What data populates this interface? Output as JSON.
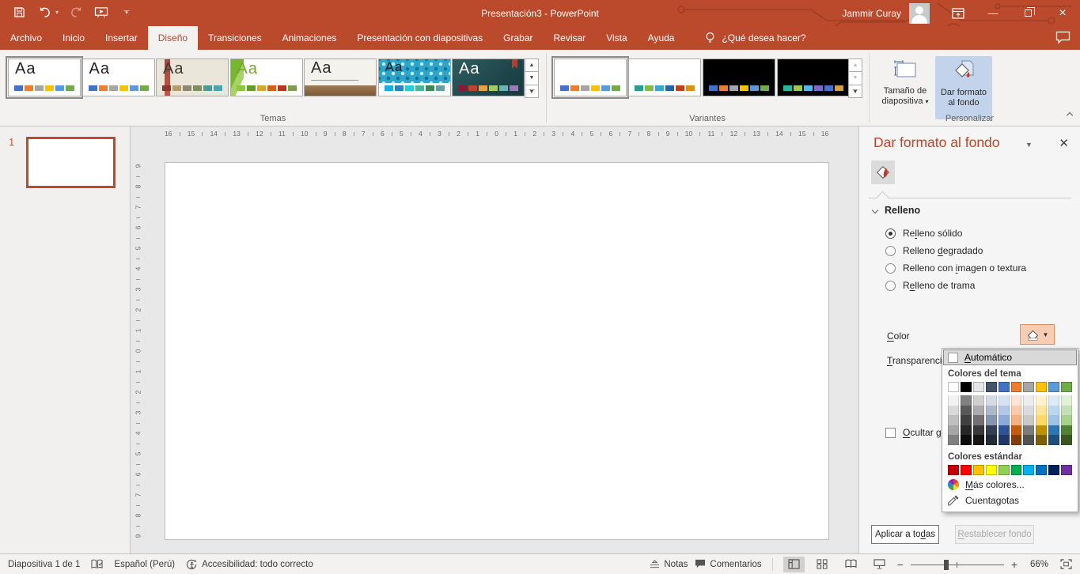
{
  "titlebar": {
    "title": "Presentación3 - PowerPoint",
    "user": "Jammir Curay"
  },
  "tabs": [
    {
      "label": "Archivo",
      "active": false
    },
    {
      "label": "Inicio",
      "active": false
    },
    {
      "label": "Insertar",
      "active": false
    },
    {
      "label": "Diseño",
      "active": true
    },
    {
      "label": "Transiciones",
      "active": false
    },
    {
      "label": "Animaciones",
      "active": false
    },
    {
      "label": "Presentación con diapositivas",
      "active": false
    },
    {
      "label": "Grabar",
      "active": false
    },
    {
      "label": "Revisar",
      "active": false
    },
    {
      "label": "Vista",
      "active": false
    },
    {
      "label": "Ayuda",
      "active": false
    }
  ],
  "help_label": "¿Qué desea hacer?",
  "ribbon": {
    "themes": {
      "label": "Temas",
      "sample": "Aa",
      "items": [
        {
          "deco": "plain",
          "bg": "#ffffff",
          "aa": "#1f1f1f",
          "chips": [
            "#4472C4",
            "#ED7D31",
            "#A5A5A5",
            "#FFC000",
            "#5B9BD5",
            "#70AD47"
          ],
          "selected": true
        },
        {
          "deco": "plain",
          "bg": "#ffffff",
          "aa": "#1f1f1f",
          "chips": [
            "#4472C4",
            "#ED7D31",
            "#A5A5A5",
            "#FFC000",
            "#5B9BD5",
            "#70AD47"
          ],
          "selected": false
        },
        {
          "deco": "beige",
          "bg": "#EAE7DA",
          "aa": "#3a3a30",
          "chips": [
            "#93342C",
            "#B59A6A",
            "#8F8776",
            "#7E8F5F",
            "#4B9A97",
            "#4FA3B1"
          ],
          "selected": false
        },
        {
          "deco": "facet",
          "bg": "#ffffff",
          "aa": "#76A430",
          "chips": [
            "#8DC63F",
            "#5E9E2F",
            "#DBA621",
            "#D2601A",
            "#B5371F",
            "#7F9B4E"
          ],
          "selected": false
        },
        {
          "deco": "gallery",
          "bg": "#F4F2ED",
          "aa": "#2b2b2b",
          "chips": [
            "#B02B56",
            "#D14E79",
            "#C44FC0",
            "#BFBEBE",
            "#7D9AA5",
            "#6A8FA0"
          ],
          "selected": false
        },
        {
          "deco": "integral",
          "bg": "#ffffff",
          "aa": "#1c1c1c",
          "chips": [
            "#1CADE4",
            "#2683C6",
            "#27CED7",
            "#42BA97",
            "#3E8853",
            "#62A39F"
          ],
          "selected": false
        },
        {
          "deco": "ion",
          "bg": "#235254",
          "aa": "#ffffff",
          "chips": [
            "#8B1A32",
            "#C34036",
            "#E8A33D",
            "#9FCE63",
            "#6AB5B0",
            "#9B7BB8"
          ],
          "selected": false
        }
      ]
    },
    "variants": {
      "label": "Variantes",
      "items": [
        {
          "bg": "#ffffff",
          "chips": [
            "#4472C4",
            "#ED7D31",
            "#A5A5A5",
            "#FFC000",
            "#5B9BD5",
            "#70AD47"
          ],
          "selected": true
        },
        {
          "bg": "#ffffff",
          "chips": [
            "#2C9C8E",
            "#84BD41",
            "#3BA7C6",
            "#2464A8",
            "#B8431F",
            "#D8940F"
          ],
          "selected": false
        },
        {
          "bg": "#000000",
          "chips": [
            "#4472C4",
            "#ED7D31",
            "#A5A5A5",
            "#FFC000",
            "#5B9BD5",
            "#70AD47"
          ],
          "selected": false
        },
        {
          "bg": "#000000",
          "chips": [
            "#2BB5A0",
            "#A2C84B",
            "#56B7E6",
            "#7B68C8",
            "#4472C4",
            "#D89C3E"
          ],
          "selected": false
        }
      ]
    },
    "customize": {
      "label": "Personalizar",
      "slide_size": "Tamaño de diapositiva",
      "format_bg": "Dar formato al fondo"
    }
  },
  "slides_panel": {
    "number": "1"
  },
  "rulers": {
    "h": [
      16,
      15,
      14,
      13,
      12,
      11,
      10,
      9,
      8,
      7,
      6,
      5,
      4,
      3,
      2,
      1,
      0,
      1,
      2,
      3,
      4,
      5,
      6,
      7,
      8,
      9,
      10,
      11,
      12,
      13,
      14,
      15,
      16
    ],
    "v": [
      9,
      8,
      7,
      6,
      5,
      4,
      3,
      2,
      1,
      0,
      1,
      2,
      3,
      4,
      5,
      6,
      7,
      8,
      9
    ]
  },
  "format_panel": {
    "title": "Dar formato al fondo",
    "section": "Relleno",
    "options": [
      {
        "label": "Re[l]leno sólido",
        "selected": true
      },
      {
        "label": "Relleno [d]egradado",
        "selected": false
      },
      {
        "label": "Relleno con [i]magen o textura",
        "selected": false
      },
      {
        "label": "R[e]lleno de trama",
        "selected": false
      }
    ],
    "hide_bg": "[O]cultar gráficos del fondo",
    "color_label": "[C]olor",
    "transparency_label": "[T]ransparencia",
    "apply_all": "Aplicar a to[d]as",
    "reset": "[R]establecer fondo"
  },
  "color_picker": {
    "automatic": "[A]utomático",
    "theme_header": "Colores del tema",
    "theme_colors": [
      "#FFFFFF",
      "#000000",
      "#E7E6E6",
      "#44546A",
      "#4472C4",
      "#ED7D31",
      "#A5A5A5",
      "#FFC000",
      "#5B9BD5",
      "#70AD47"
    ],
    "theme_shades": [
      [
        "#F2F2F2",
        "#D9D9D9",
        "#BFBFBF",
        "#A6A6A6",
        "#808080"
      ],
      [
        "#808080",
        "#595959",
        "#404040",
        "#262626",
        "#0D0D0D"
      ],
      [
        "#D0CECE",
        "#AEAAAA",
        "#757171",
        "#3A3838",
        "#161616"
      ],
      [
        "#D6DCE5",
        "#ACB9CA",
        "#8496B0",
        "#333F50",
        "#222B35"
      ],
      [
        "#D9E2F3",
        "#B4C7E7",
        "#8EAADB",
        "#2F5597",
        "#1F3864"
      ],
      [
        "#FBE5D6",
        "#F8CBAD",
        "#F4B183",
        "#C55A11",
        "#843C0C"
      ],
      [
        "#EDEDED",
        "#DBDBDB",
        "#C9C9C9",
        "#7B7B7B",
        "#525252"
      ],
      [
        "#FFF2CC",
        "#FFE599",
        "#FFD966",
        "#BF9000",
        "#7F6000"
      ],
      [
        "#DEEBF7",
        "#BDD7EE",
        "#9DC3E6",
        "#2E75B6",
        "#1F4E79"
      ],
      [
        "#E2F0D9",
        "#C5E0B4",
        "#A9D18E",
        "#548235",
        "#385723"
      ]
    ],
    "standard_header": "Colores estándar",
    "standard_colors": [
      "#C00000",
      "#FF0000",
      "#FFC000",
      "#FFFF00",
      "#92D050",
      "#00B050",
      "#00B0F0",
      "#0070C0",
      "#002060",
      "#7030A0"
    ],
    "more": "[M]ás colores...",
    "eyedropper": "Cuentagotas"
  },
  "statusbar": {
    "slide_info": "Diapositiva 1 de 1",
    "language": "Español (Perú)",
    "accessibility": "Accesibilidad: todo correcto",
    "notes": "Notas",
    "comments": "Comentarios",
    "zoom": "66%"
  }
}
